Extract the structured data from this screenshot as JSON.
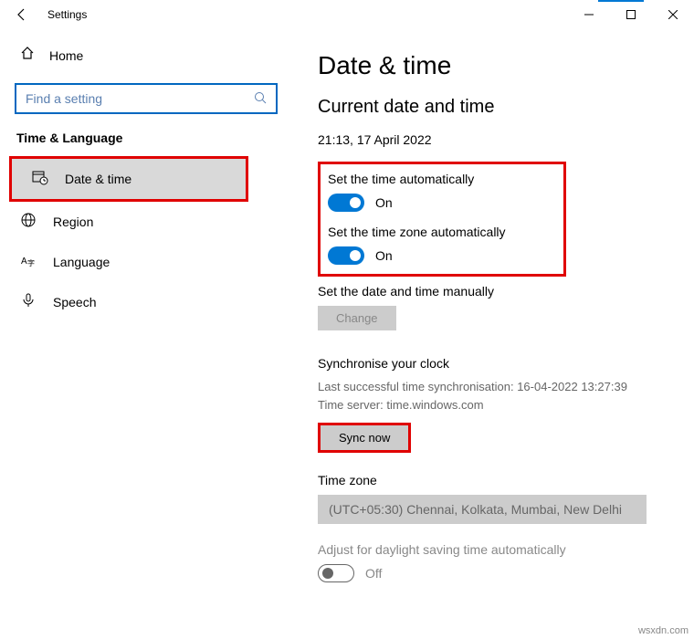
{
  "window": {
    "title": "Settings"
  },
  "sidebar": {
    "home_label": "Home",
    "search_placeholder": "Find a setting",
    "section_title": "Time & Language",
    "items": [
      {
        "label": "Date & time"
      },
      {
        "label": "Region"
      },
      {
        "label": "Language"
      },
      {
        "label": "Speech"
      }
    ]
  },
  "content": {
    "heading": "Date & time",
    "subheading": "Current date and time",
    "current_datetime": "21:13, 17 April 2022",
    "auto_time_label": "Set the time automatically",
    "auto_time_state": "On",
    "auto_tz_label": "Set the time zone automatically",
    "auto_tz_state": "On",
    "manual_label": "Set the date and time manually",
    "change_button": "Change",
    "sync_title": "Synchronise your clock",
    "sync_last": "Last successful time synchronisation: 16-04-2022 13:27:39",
    "sync_server": "Time server: time.windows.com",
    "sync_button": "Sync now",
    "tz_title": "Time zone",
    "tz_value": "(UTC+05:30) Chennai, Kolkata, Mumbai, New Delhi",
    "dst_label": "Adjust for daylight saving time automatically",
    "dst_state": "Off"
  },
  "watermark": "wsxdn.com"
}
